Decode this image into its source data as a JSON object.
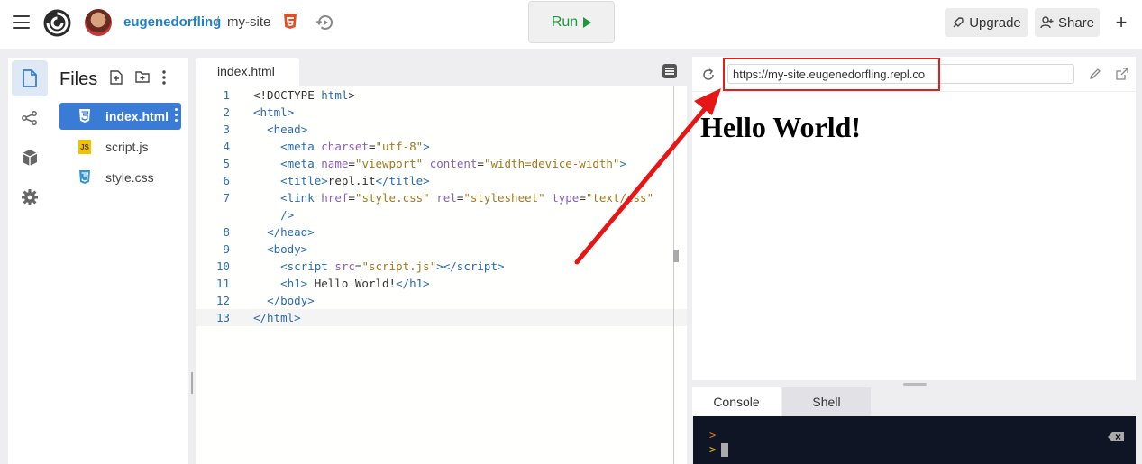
{
  "topbar": {
    "user": "eugenedorfling",
    "separator": "/",
    "repl_name": "my-site",
    "run_label": "Run",
    "upgrade_label": "Upgrade",
    "share_label": "Share",
    "plus_label": "+"
  },
  "files_panel": {
    "title": "Files",
    "items": [
      {
        "name": "index.html",
        "icon": "html5-icon",
        "active": true
      },
      {
        "name": "script.js",
        "icon": "js-icon",
        "active": false
      },
      {
        "name": "style.css",
        "icon": "css3-icon",
        "active": false
      }
    ]
  },
  "editor": {
    "tab_label": "index.html",
    "line_numbers": [
      "1",
      "2",
      "3",
      "4",
      "5",
      "6",
      "7",
      "",
      "8",
      "9",
      "10",
      "11",
      "12",
      "13"
    ]
  },
  "preview": {
    "url": "https://my-site.eugenedorfling.repl.co",
    "heading": "Hello World!"
  },
  "console": {
    "tabs": [
      "Console",
      "Shell"
    ],
    "prompt_symbol": ">"
  },
  "colors": {
    "accent": "#3a7bd5",
    "run_green": "#1a9a3c",
    "highlight_red": "#e02020",
    "console_bg": "#0f1525"
  }
}
